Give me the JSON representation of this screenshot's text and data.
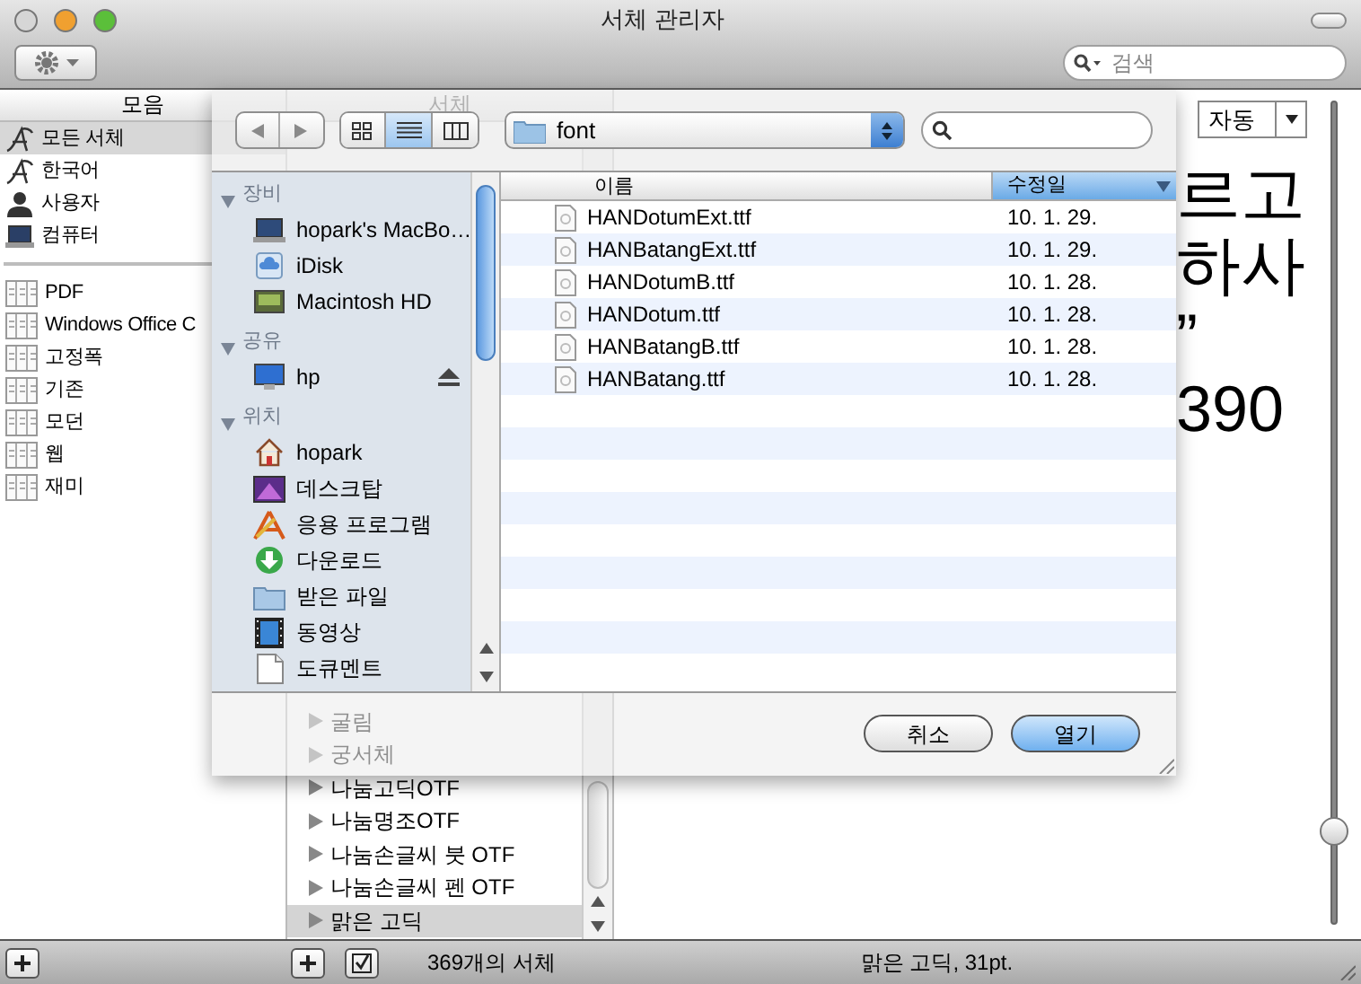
{
  "window": {
    "title": "서체 관리자",
    "search": {
      "placeholder": "검색"
    }
  },
  "traffic_lights": [
    {
      "kind": "close",
      "disabled": true
    },
    {
      "kind": "minimize",
      "disabled": false
    },
    {
      "kind": "zoom",
      "disabled": false
    }
  ],
  "collections": {
    "header": "모음",
    "libraries": [
      {
        "label": "모든 서체",
        "kind": "font",
        "selected": true
      },
      {
        "label": "한국어",
        "kind": "font",
        "selected": false
      },
      {
        "label": "사용자",
        "kind": "user",
        "selected": false
      },
      {
        "label": "컴퓨터",
        "kind": "computer",
        "selected": false
      }
    ],
    "sets": [
      {
        "label": "PDF",
        "selected": false
      },
      {
        "label": "Windows Office C",
        "selected": false
      },
      {
        "label": "고정폭",
        "selected": false
      },
      {
        "label": "기존",
        "selected": false
      },
      {
        "label": "모던",
        "selected": false
      },
      {
        "label": "웹",
        "selected": false
      },
      {
        "label": "재미",
        "selected": false
      }
    ]
  },
  "font_list": {
    "header": "서체",
    "items": [
      {
        "label": "굴림",
        "selected": false
      },
      {
        "label": "궁서체",
        "selected": false
      },
      {
        "label": "나눔고딕OTF",
        "selected": false
      },
      {
        "label": "나눔명조OTF",
        "selected": false
      },
      {
        "label": "나눔손글씨 붓 OTF",
        "selected": false
      },
      {
        "label": "나눔손글씨 펜 OTF",
        "selected": false
      },
      {
        "label": "맑은 고딕",
        "selected": true
      }
    ]
  },
  "preview": {
    "size_menu": {
      "value": "자동"
    },
    "lines": [
      "르고",
      "하사",
      "”",
      "390"
    ],
    "size_slider": {
      "level": 0.1
    }
  },
  "status_bar": {
    "count": "369개의 서체",
    "selection": "맑은 고딕, 31pt."
  },
  "open_sheet": {
    "path": "font",
    "view_modes": [
      {
        "kind": "icon",
        "selected": false
      },
      {
        "kind": "list",
        "selected": true
      },
      {
        "kind": "column",
        "selected": false
      }
    ],
    "sidebar": [
      {
        "label": "장비",
        "expanded": true,
        "items": [
          {
            "label": "hopark's MacBo…",
            "kind": "laptop",
            "ejectable": false
          },
          {
            "label": "iDisk",
            "kind": "idisk",
            "ejectable": false
          },
          {
            "label": "Macintosh HD",
            "kind": "disk",
            "ejectable": false
          }
        ]
      },
      {
        "label": "공유",
        "expanded": true,
        "items": [
          {
            "label": "hp",
            "kind": "monitor",
            "ejectable": true
          }
        ]
      },
      {
        "label": "위치",
        "expanded": true,
        "items": [
          {
            "label": "hopark",
            "kind": "home",
            "ejectable": false
          },
          {
            "label": "데스크탑",
            "kind": "desktop",
            "ejectable": false
          },
          {
            "label": "응용 프로그램",
            "kind": "apps",
            "ejectable": false
          },
          {
            "label": "다운로드",
            "kind": "download",
            "ejectable": false
          },
          {
            "label": "받은 파일",
            "kind": "folder",
            "ejectable": false
          },
          {
            "label": "동영상",
            "kind": "movie",
            "ejectable": false
          },
          {
            "label": "도큐멘트",
            "kind": "document",
            "ejectable": false
          }
        ]
      }
    ],
    "columns": [
      {
        "label": "이름",
        "selected": false
      },
      {
        "label": "수정일",
        "selected": true
      }
    ],
    "files": [
      {
        "name": "HANDotumExt.ttf",
        "date": "10. 1. 29."
      },
      {
        "name": "HANBatangExt.ttf",
        "date": "10. 1. 29."
      },
      {
        "name": "HANDotumB.ttf",
        "date": "10. 1. 28."
      },
      {
        "name": "HANDotum.ttf",
        "date": "10. 1. 28."
      },
      {
        "name": "HANBatangB.ttf",
        "date": "10. 1. 28."
      },
      {
        "name": "HANBatang.ttf",
        "date": "10. 1. 28."
      }
    ],
    "buttons": [
      {
        "label": "취소",
        "kind": "cancel"
      },
      {
        "label": "열기",
        "kind": "default"
      }
    ]
  }
}
